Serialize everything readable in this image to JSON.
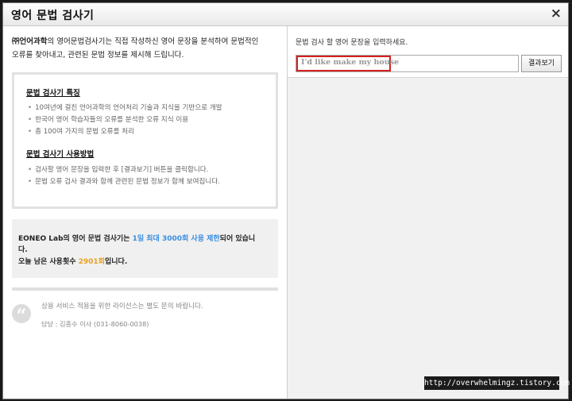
{
  "dialog": {
    "title": "영어 문법 검사기",
    "close_label": "×"
  },
  "intro": {
    "company": "㈜언어과학",
    "text_1": "의 영어문법검사기는 직접 작성하신 영어 문장을 분석하여 문법적인",
    "text_2": "오류를 찾아내고, 관련된 문법 정보를 제시해 드립니다."
  },
  "features": {
    "heading": "문법 검사기 특징",
    "items": [
      "10여년에 걸친 언어과학의 언어처리 기술과 지식을 기반으로 개발",
      "한국어 영어 학습자들의 오류를 분석한 오류 지식 이용",
      "총 100여 가지의 문법 오류를 처리"
    ]
  },
  "usage": {
    "heading": "문법 검사기 사용방법",
    "items": [
      "검사할 영어 문장을 입력한 후 [결과보기] 버튼을 클릭합니다.",
      "문법 오류 검사 결과와 함께 관련된 문법 정보가 함께 보여집니다."
    ]
  },
  "limit": {
    "prefix": "EONEO Lab의 영어 문법 검사기는 ",
    "highlight": "1일 최대 3000회 사용 제한",
    "suffix": "되어 있습니",
    "line_2": "다.",
    "remain_prefix": "오늘 남은 사용횟수 ",
    "remain_count": "2901회",
    "remain_suffix": "입니다."
  },
  "contact": {
    "line_1": "상용 서비스 적용을 위한 라이선스는 별도 문의 바랍니다.",
    "line_2": "담당 : 김종수 이사 (031-8060-0038)"
  },
  "checker": {
    "prompt": "문법 검사 할 영어 문장을 입력하세요.",
    "input_value": "I'd like make my house",
    "button_label": "결과보기"
  },
  "watermark": "http://overwhelmingz.tistory.com",
  "colors": {
    "accent_blue": "#3a8ee0",
    "accent_orange": "#e8a020",
    "highlight_red": "#d62020"
  }
}
